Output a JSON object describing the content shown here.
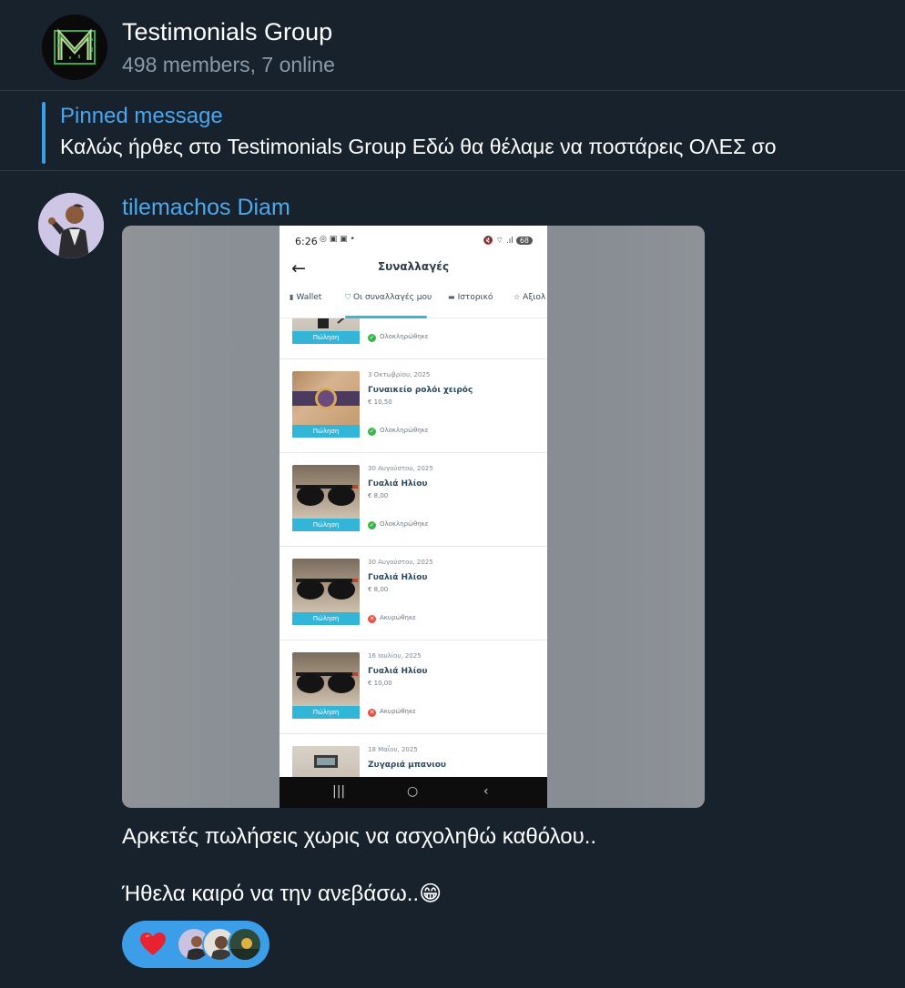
{
  "chat": {
    "title": "Testimonials Group",
    "subtitle": "498 members, 7 online",
    "avatar_icon": "matrix-m-logo-icon"
  },
  "pinned": {
    "label": "Pinned message",
    "text": "Καλώς ήρθες στο Testimonials Group  Εδώ θα θέλαμε να ποστάρεις ΟΛΕΣ σο"
  },
  "message": {
    "sender": "tilemachos Diam",
    "line1": "Αρκετές πωλήσεις χωρις να ασχοληθώ καθόλου..",
    "line2": "Ήθελα καιρό να την ανεβάσω..",
    "emoji": "😁",
    "reaction": {
      "emoji": "heart-icon",
      "color": "#e8232f",
      "count_avatars": 3
    }
  },
  "screenshot": {
    "status_time": "6:26",
    "status_icons": "◎ ▣ ▣ •",
    "status_right": "🔇 ⌔ .ıl",
    "battery": "68",
    "title": "Συναλλαγές",
    "tabs": [
      "Wallet",
      "Οι συναλλαγές μου",
      "Ιστορικό",
      "Αξιολ"
    ],
    "sale_label": "Πώληση",
    "rows": [
      {
        "date": "",
        "name": "",
        "price": "",
        "status": "Ολοκληρώθηκε",
        "ok": true
      },
      {
        "date": "3 Οκτωβρίου, 2025",
        "name": "Γυναικείο ρολόι χειρός",
        "price": "€ 10,50",
        "status": "Ολοκληρώθηκε",
        "ok": true
      },
      {
        "date": "30 Αυγούστου, 2025",
        "name": "Γυαλιά Ηλίου",
        "price": "€ 8,00",
        "status": "Ολοκληρώθηκε",
        "ok": true
      },
      {
        "date": "30 Αυγούστου, 2025",
        "name": "Γυαλιά Ηλίου",
        "price": "€ 8,00",
        "status": "Ακυρώθηκε",
        "ok": false
      },
      {
        "date": "16 Ιουλίου, 2025",
        "name": "Γυαλιά Ηλίου",
        "price": "€ 10,00",
        "status": "Ακυρώθηκε",
        "ok": false
      },
      {
        "date": "18 Μαΐου, 2025",
        "name": "Ζυγαριά μπανιου",
        "price": "",
        "status": "",
        "ok": true
      }
    ]
  },
  "colors": {
    "background": "#18222d",
    "accent": "#3c9ee9",
    "link": "#4ea8ec"
  }
}
